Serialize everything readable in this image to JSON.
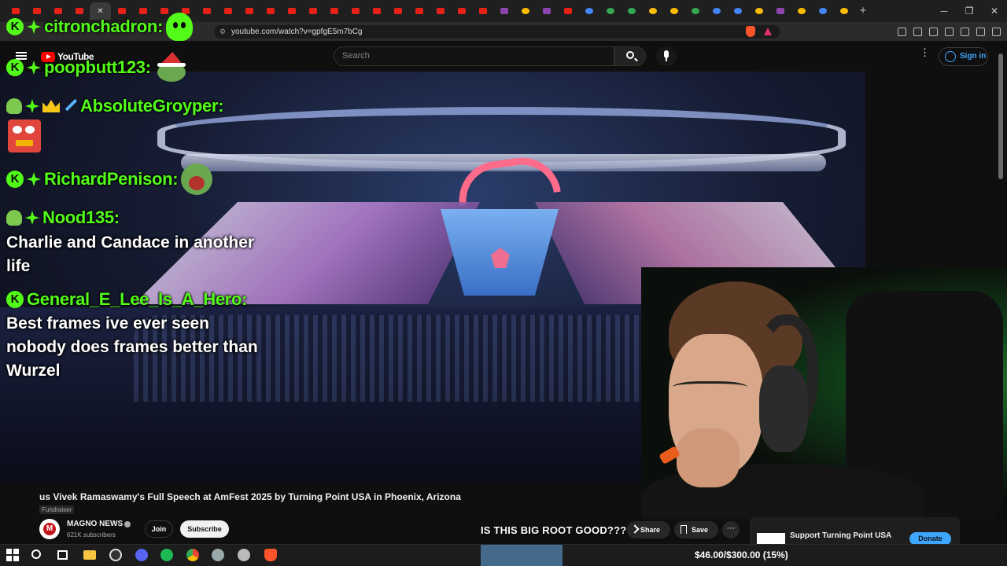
{
  "browser": {
    "url": "youtube.com/watch?v=gpfgE5m7bCg",
    "new_tab_label": "+",
    "window_controls": {
      "minimize": "─",
      "maximize": "❐",
      "close": "✕"
    }
  },
  "youtube_header": {
    "logo_text": "YouTube",
    "search_placeholder": "Search",
    "sign_in_label": "Sign in",
    "menu_glyph": "⋮"
  },
  "chat": {
    "messages": [
      {
        "username": "citronchadron:",
        "text": "",
        "badges": [
          "kick-icon",
          "diamond-icon"
        ],
        "emote": "green-blob-avatar"
      },
      {
        "username": "poopbutt123:",
        "text": "",
        "badges": [
          "kick-icon",
          "diamond-icon"
        ],
        "emote": "pepe-santa-emote"
      },
      {
        "username": "AbsoluteGroyper:",
        "text": "",
        "badges": [
          "helmet-icon",
          "diamond-icon",
          "crown-icon",
          "sword-icon"
        ],
        "emote": "angry-face-emote"
      },
      {
        "username": "RichardPenison:",
        "text": "",
        "badges": [
          "kick-icon",
          "diamond-icon"
        ],
        "emote": "pepe-scream-emote"
      },
      {
        "username": "Nood135:",
        "text": "Charlie and Candace in another life",
        "badges": [
          "helmet-icon",
          "diamond-icon"
        ]
      },
      {
        "username": "General_E_Lee_Is_A_Hero:",
        "text": "Best frames ive ever seen nobody does frames better than Wurzel",
        "badges": [
          "kick-icon"
        ]
      }
    ]
  },
  "video": {
    "title": "us Vivek Ramaswamy's Full Speech at AmFest 2025 by Turning Point USA in Phoenix, Arizona",
    "tag": "Fundraiser",
    "caption": "IS THIS BIG ROOT GOOD????"
  },
  "channel": {
    "name": "MAGNO NEWS",
    "avatar_letter": "M",
    "subscribers": "621K subscribers",
    "join_label": "Join",
    "subscribe_label": "Subscribe"
  },
  "actions": {
    "share_label": "Share",
    "save_label": "Save",
    "more_label": "···"
  },
  "fundraiser": {
    "text": "Support Turning Point USA",
    "donate_label": "Donate"
  },
  "taskbar": {
    "goal_text": "$46.00/$300.00 (15%)",
    "goal_fraction": 0.15
  },
  "colors": {
    "kick_green": "#53fc18",
    "youtube_red": "#ff0000",
    "link_blue": "#3ea6ff"
  }
}
